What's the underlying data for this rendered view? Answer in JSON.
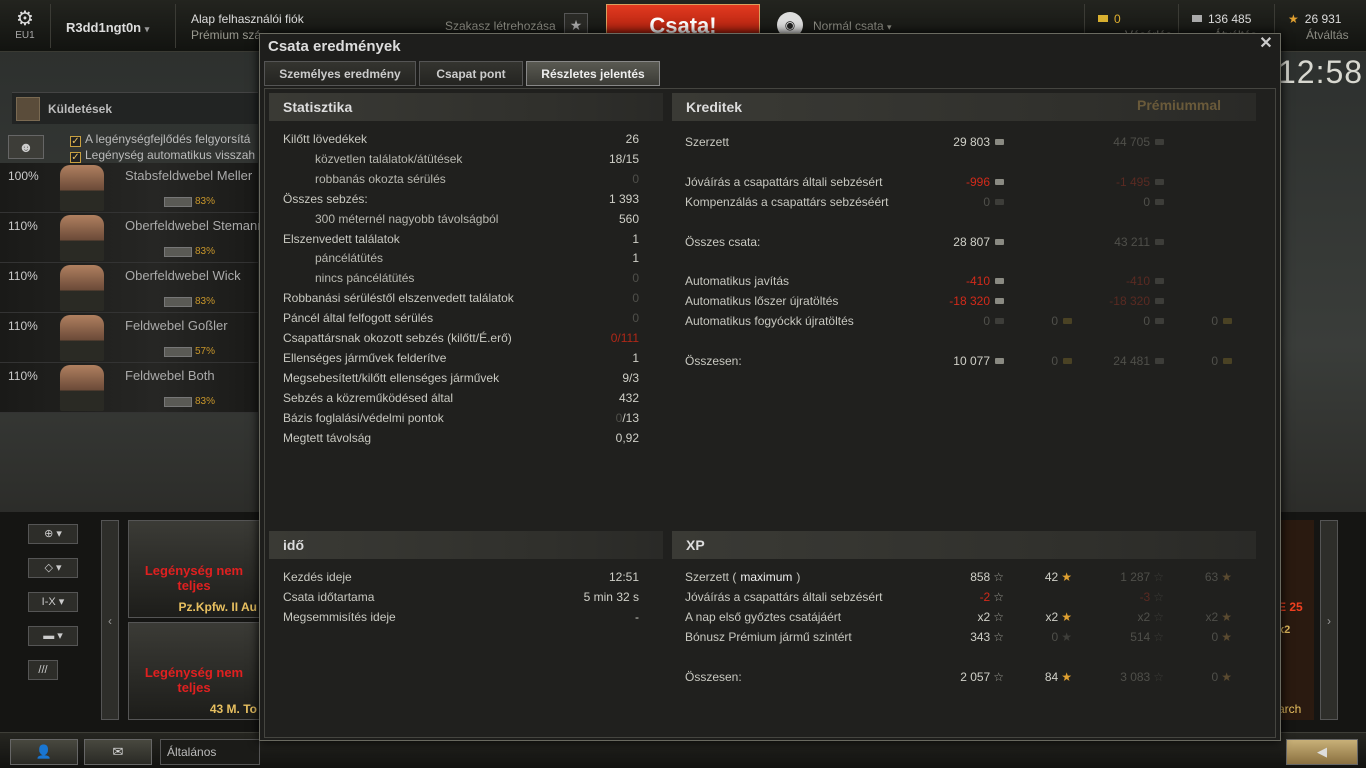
{
  "topbar": {
    "server": "EU1",
    "username": "R3dd1ngt0n",
    "account_type": "Alap felhasználói fiók",
    "premium_link": "Prémium szá",
    "platoon": "Szakasz létrehozása",
    "battle_button": "Csata!",
    "battle_mode": "Normál csata",
    "gold": "0",
    "gold_sub": "Vásárlás",
    "credits": "136 485",
    "credits_sub": "Átváltás",
    "free_xp": "26 931",
    "free_xp_sub": "Átváltás"
  },
  "clock": "12:58",
  "left": {
    "missions": "Küldetések",
    "crew_options": [
      "A legénységfejlődés felgyorsítá",
      "Legénység automatikus visszah"
    ],
    "crew": [
      {
        "pct": "100%",
        "name": "Stabsfeldwebel Meller",
        "skill": "83%"
      },
      {
        "pct": "110%",
        "name": "Oberfeldwebel Stemann",
        "skill": "83%"
      },
      {
        "pct": "110%",
        "name": "Oberfeldwebel Wick",
        "skill": "83%"
      },
      {
        "pct": "110%",
        "name": "Feldwebel Goßler",
        "skill": "57%"
      },
      {
        "pct": "110%",
        "name": "Feldwebel Both",
        "skill": "83%"
      }
    ]
  },
  "carousel": {
    "filter_tier": "I-X",
    "tanks": [
      {
        "warning": "Legénység nem teljes",
        "name": "Pz.Kpfw. II Au"
      },
      {
        "warning": "Legénység nem teljes",
        "name": "43 M. To"
      }
    ],
    "right_tank": {
      "label_a": "E 25",
      "label_b": "x2",
      "label_c": "arch"
    }
  },
  "bottombar": {
    "chat_channel": "Általános"
  },
  "dialog": {
    "title": "Csata eredmények",
    "tabs": [
      "Személyes eredmény",
      "Csapat pont",
      "Részletes jelentés"
    ],
    "statistics": {
      "header": "Statisztika",
      "rows": [
        {
          "label": "Kilőtt lövedékek",
          "value": "26"
        },
        {
          "label": "közvetlen találatok/átütések",
          "value": "18/15"
        },
        {
          "label": "robbanás okozta sérülés",
          "value": "0"
        },
        {
          "label": "Összes sebzés:",
          "value": "1 393"
        },
        {
          "label": "300 méternél nagyobb távolságból",
          "value": "560"
        },
        {
          "label": "Elszenvedett találatok",
          "value": "1"
        },
        {
          "label": "páncélátütés",
          "value": "1"
        },
        {
          "label": "nincs páncélátütés",
          "value": "0"
        },
        {
          "label": "Robbanási sérüléstől elszenvedett találatok",
          "value": "0"
        },
        {
          "label": "Páncél által felfogott sérülés",
          "value": "0"
        },
        {
          "label": "Csapattársnak okozott sebzés (kilőtt/É.erő)",
          "value": "0/111"
        },
        {
          "label": "Ellenséges járművek felderítve",
          "value": "1"
        },
        {
          "label": "Megsebesített/kilőtt ellenséges járművek",
          "value": "9/3"
        },
        {
          "label": "Sebzés a közreműködésed által",
          "value": "432"
        },
        {
          "label": "Bázis foglalási/védelmi pontok",
          "value_a": "0",
          "value_b": "/13"
        },
        {
          "label": "Megtett távolság",
          "value": "0,92"
        }
      ]
    },
    "credits": {
      "header": "Kreditek",
      "premium_header": "Prémiummal",
      "rows": [
        {
          "label": "Szerzett",
          "value": "29 803",
          "prem": "44 705"
        },
        {
          "label": "Jóváírás a csapattárs általi sebzésért",
          "value": "-996",
          "prem": "-1 495"
        },
        {
          "label": "Kompenzálás a csapattárs sebzéséért",
          "value": "0",
          "prem": "0"
        },
        {
          "label": "Összes csata:",
          "value": "28 807",
          "prem": "43 211"
        },
        {
          "label": "Automatikus javítás",
          "value": "-410",
          "prem": "-410"
        },
        {
          "label": "Automatikus lőszer újratöltés",
          "value": "-18 320",
          "prem": "-18 320"
        },
        {
          "label": "Automatikus fogyóckk újratöltés",
          "value": "0",
          "gold": "0",
          "prem": "0",
          "prem_gold": "0"
        },
        {
          "label": "Összesen:",
          "value": "10 077",
          "gold": "0",
          "prem": "24 481",
          "prem_gold": "0"
        }
      ]
    },
    "time": {
      "header": "idő",
      "rows": [
        {
          "label": "Kezdés ideje",
          "value": "12:51"
        },
        {
          "label": "Csata időtartama",
          "value": "5 min 32 s"
        },
        {
          "label": "Megsemmisítés ideje",
          "value": "-"
        }
      ]
    },
    "xp": {
      "header": "XP",
      "earned_label": "Szerzett (",
      "earned_max": "maximum",
      "earned_close": ")",
      "rows": [
        {
          "value": "858",
          "free": "42",
          "prem": "1 287",
          "prem_free": "63"
        },
        {
          "label": "Jóváírás a csapattárs általi sebzésért",
          "value": "-2",
          "prem": "-3"
        },
        {
          "label": "A nap első győztes csatájáért",
          "value": "x2",
          "free": "x2",
          "prem": "x2",
          "prem_free": "x2"
        },
        {
          "label": "Bónusz Prémium jármű szintért",
          "value": "343",
          "free": "0",
          "prem": "514",
          "prem_free": "0"
        },
        {
          "label": "Összesen:",
          "value": "2 057",
          "free": "84",
          "prem": "3 083",
          "prem_free": "0"
        }
      ]
    }
  }
}
